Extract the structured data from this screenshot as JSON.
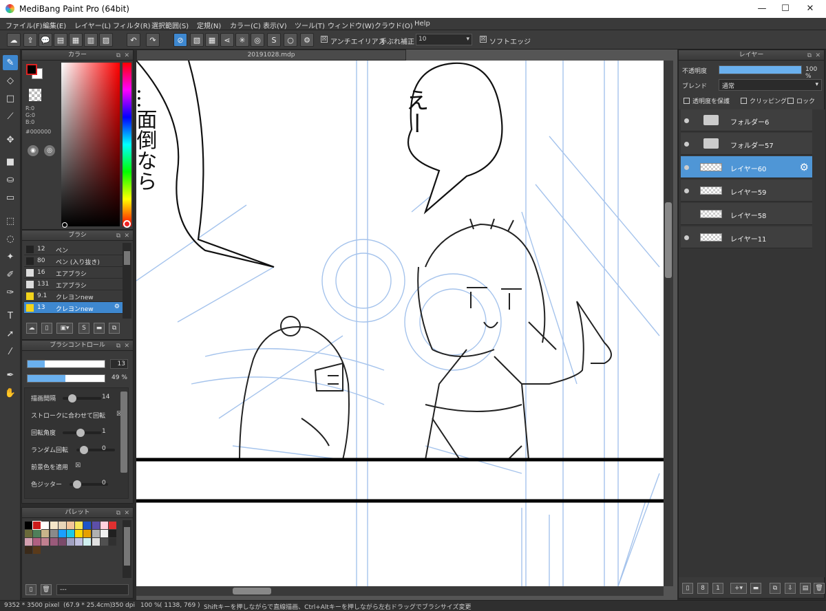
{
  "window": {
    "title": "MediBang Paint Pro (64bit)",
    "minimize": "—",
    "maximize": "☐",
    "close": "✕"
  },
  "menu": [
    "ファイル(F)",
    "編集(E)",
    "レイヤー(L)",
    "フィルタ(R)",
    "選択範囲(S)",
    "定規(N)",
    "カラー(C)",
    "表示(V)",
    "ツール(T)",
    "ウィンドウ(W)",
    "クラウド(O)",
    "Help"
  ],
  "toolbar": {
    "antialias_label": "アンチエイリアス",
    "antialias_checked": "☒",
    "stabilizer_label": "手ぶれ補正",
    "stabilizer_value": "10",
    "soft_edge_label": "ソフトエッジ",
    "soft_edge_checked": "☒"
  },
  "color_panel": {
    "title": "カラー",
    "r": "R:0",
    "g": "G:0",
    "b": "B:0",
    "hex": "#000000",
    "foreground": "#000000",
    "background": "#ffffff"
  },
  "brush_panel": {
    "title": "ブラシ",
    "items": [
      {
        "size": "12",
        "name": "ペン",
        "color": "#222222"
      },
      {
        "size": "80",
        "name": "ペン (入り抜き)",
        "color": "#222222"
      },
      {
        "size": "16",
        "name": "エアブラシ",
        "color": "#dddddd"
      },
      {
        "size": "131",
        "name": "エアブラシ",
        "color": "#dddddd"
      },
      {
        "size": "9.1",
        "name": "クレヨンnew",
        "color": "#f2d31b"
      },
      {
        "size": "13",
        "name": "クレヨンnew",
        "color": "#f2d31b"
      }
    ]
  },
  "brush_control": {
    "title": "ブラシコントロール",
    "size_value": "13",
    "size_level": 0.22,
    "opacity_value": "49 %",
    "opacity_level": 0.49,
    "rows": [
      {
        "label": "描画間隔",
        "value": "14",
        "type": "slider"
      },
      {
        "label": "ストロークに合わせて回転",
        "value": "☒",
        "type": "check"
      },
      {
        "label": "回転角度",
        "value": "1",
        "type": "slider"
      },
      {
        "label": "ランダム回転",
        "value": "0",
        "type": "slider"
      },
      {
        "label": "前景色を適用",
        "value": "☒",
        "type": "check"
      },
      {
        "label": "色ジッター",
        "value": "0",
        "type": "slider"
      }
    ]
  },
  "palette": {
    "title": "パレット",
    "footer": "---",
    "colors": [
      "#000000",
      "#cc1b1b",
      "#ffffff",
      "#f5e6c8",
      "#e8d5b8",
      "#f2c49b",
      "#f7e55a",
      "#1e55c8",
      "#5d4fa8",
      "#ffd0dc",
      "#e03030",
      "#6a6a3a",
      "#4f7f5a",
      "#c8b48a",
      "#8a8a8a",
      "#1aa0ff",
      "#1ec8e6",
      "#ffd700",
      "#e6a000",
      "#b0b0b0",
      "#f0f0f0",
      "#202020",
      "#d4a0b0",
      "#b06080",
      "#c08090",
      "#9a5a7a",
      "#7a4a6a",
      "#a0a0c0",
      "#c0c0e0",
      "#d0f0f0",
      "#e0e0e0",
      "#505050",
      "#303030",
      "#3a2a1a",
      "#5a3a1a"
    ]
  },
  "document": {
    "tab": "20191028.mdp"
  },
  "canvas": {
    "speech_left": "…面倒なら",
    "speech_right": "えー"
  },
  "layers": {
    "title": "レイヤー",
    "opacity_label": "不透明度",
    "opacity_value": "100 %",
    "opacity_level": 1.0,
    "blend_label": "ブレンド",
    "blend_value": "通常",
    "protect_label": "透明度を保護",
    "clipping_label": "クリッピング",
    "lock_label": "ロック",
    "items": [
      {
        "name": "フォルダー6",
        "type": "folder",
        "visible": true,
        "selected": false
      },
      {
        "name": "フォルダー57",
        "type": "folder",
        "visible": true,
        "selected": false
      },
      {
        "name": "レイヤー60",
        "type": "layer",
        "visible": true,
        "selected": true
      },
      {
        "name": "レイヤー59",
        "type": "layer",
        "visible": true,
        "selected": false
      },
      {
        "name": "レイヤー58",
        "type": "layer",
        "visible": false,
        "selected": false
      },
      {
        "name": "レイヤー11",
        "type": "layer",
        "visible": true,
        "selected": false
      }
    ]
  },
  "status": {
    "dimensions": "9352 * 3500 pixel",
    "physical": "(67.9 * 25.4cm)",
    "dpi": "350 dpi",
    "zoom": "100 %",
    "cursor": "( 1138, 769 )",
    "hint": "Shiftキーを押しながらで直線描画、Ctrl+Altキーを押しながら左右ドラッグでブラシサイズ変更"
  }
}
